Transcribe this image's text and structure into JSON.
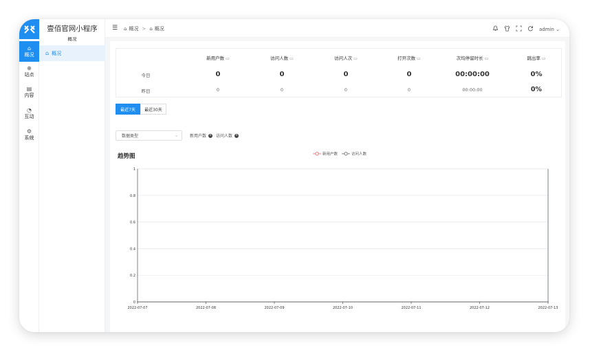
{
  "app": {
    "title": "壹佰官网小程序",
    "subtitle": "概况"
  },
  "rail": {
    "items": [
      {
        "label": "概况",
        "icon": "home-icon",
        "glyph": "⌂",
        "active": true
      },
      {
        "label": "站点",
        "icon": "globe-icon",
        "glyph": "⊕",
        "active": false
      },
      {
        "label": "内容",
        "icon": "document-icon",
        "glyph": "▤",
        "active": false
      },
      {
        "label": "互动",
        "icon": "chat-icon",
        "glyph": "◔",
        "active": false
      },
      {
        "label": "系统",
        "icon": "gear-icon",
        "glyph": "⚙",
        "active": false
      }
    ]
  },
  "sidebar": {
    "items": [
      {
        "label": "概况",
        "icon": "home-icon",
        "glyph": "⌂"
      }
    ]
  },
  "header": {
    "breadcrumb": [
      {
        "label": "概况",
        "glyph": "⌂"
      },
      {
        "label": "概况",
        "glyph": "⌂"
      }
    ],
    "separator": ">",
    "icons": [
      {
        "name": "bell-icon",
        "glyph": "🔔"
      },
      {
        "name": "shirt-icon",
        "glyph": "👕"
      },
      {
        "name": "fullscreen-icon",
        "glyph": "⛶"
      },
      {
        "name": "refresh-icon",
        "glyph": "⟳"
      }
    ],
    "user": "admin",
    "user_chevron": "⌄"
  },
  "stats": {
    "columns": [
      "新用户数",
      "访问人数",
      "访问人次",
      "打开次数",
      "次均停留时长",
      "跳出率"
    ],
    "rows": [
      {
        "label": "今日",
        "values": [
          "0",
          "0",
          "0",
          "0",
          "00:00:00",
          "0%"
        ]
      },
      {
        "label": "昨日",
        "values": [
          "0",
          "0",
          "0",
          "0",
          "00:00:00",
          "0%"
        ]
      }
    ]
  },
  "range_tabs": {
    "active": "最近7天",
    "other": "最近30天"
  },
  "filter": {
    "placeholder": "数据类型",
    "chips": [
      "新用户数",
      "访问人数"
    ]
  },
  "chart_title": "趋势图",
  "chart_data": {
    "type": "line",
    "title": "趋势图",
    "x": [
      "2022-07-07",
      "2022-07-08",
      "2022-07-09",
      "2022-07-10",
      "2022-07-11",
      "2022-07-12",
      "2022-07-13"
    ],
    "series": [
      {
        "name": "新用户数",
        "values": [
          0,
          0,
          0,
          0,
          0,
          0,
          0
        ],
        "color": "#ee6666"
      },
      {
        "name": "访问人数",
        "values": [
          0,
          0,
          0,
          0,
          0,
          0,
          0
        ],
        "color": "#666666"
      }
    ],
    "ylim": [
      0,
      1
    ],
    "yticks": [
      "0",
      "0.2",
      "0.4",
      "0.6",
      "0.8",
      "1"
    ],
    "grid": true,
    "legend": "top-center"
  },
  "colors": {
    "accent": "#1f8ef1",
    "active_bg": "#e7f2fd"
  }
}
